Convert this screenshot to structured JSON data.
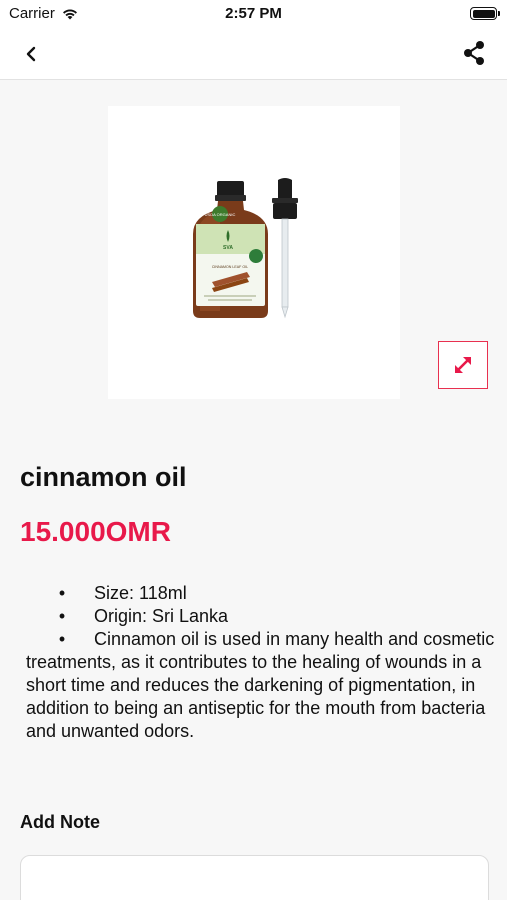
{
  "status_bar": {
    "carrier": "Carrier",
    "time": "2:57 PM"
  },
  "nav": {
    "back_icon": "chevron-left-icon",
    "share_icon": "share-icon"
  },
  "product": {
    "title": "cinnamon oil",
    "price": "15.000OMR",
    "bullets": [
      {
        "bullet": "•",
        "text": "Size: 118ml"
      },
      {
        "bullet": "•",
        "text": "Origin: Sri Lanka"
      },
      {
        "bullet": "•",
        "text": "Cinnamon oil is used in many health and cosmetic treatments, as it contributes to the healing of wounds in a short time and reduces the darkening of pigmentation, in addition to being an antiseptic for the mouth from bacteria and unwanted odors."
      }
    ],
    "bottle_label": {
      "brand": "SVA",
      "badge": "USDA ORGANIC",
      "product_line": "CINNAMON LEAF OIL"
    },
    "expand_icon": "expand-arrows-icon"
  },
  "note": {
    "label": "Add Note",
    "placeholder": ""
  },
  "colors": {
    "accent": "#e8194a",
    "expand_border": "#e8304f",
    "background": "#f7f7f7"
  }
}
